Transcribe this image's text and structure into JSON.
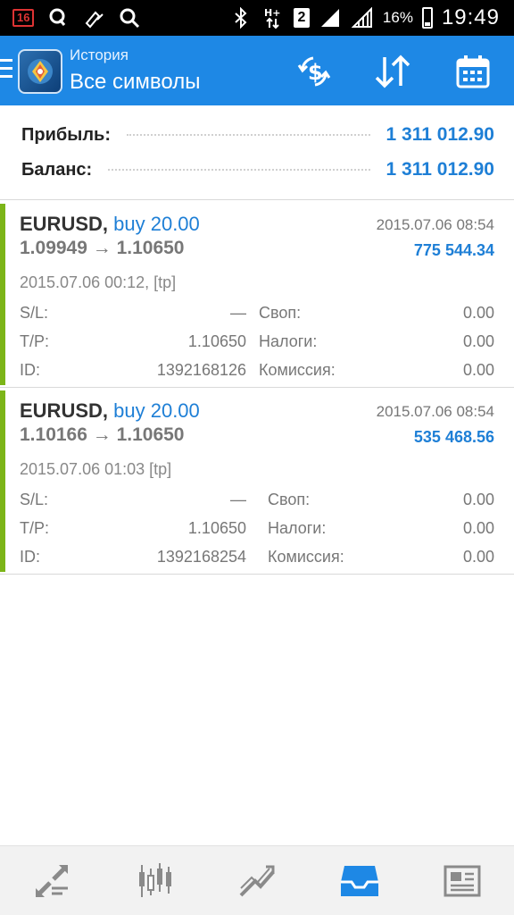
{
  "status_bar": {
    "notification_badge": "16",
    "sim_slot": "2",
    "battery_percent": "16%",
    "time": "19:49",
    "icons": [
      "notification-badge",
      "qiwi-visa-icon",
      "pen-coins-icon",
      "search-icon",
      "bluetooth-icon",
      "data-arrows-icon",
      "sim-icon",
      "signal-icon",
      "signal-icon",
      "battery-icon"
    ]
  },
  "app_bar": {
    "title_small": "История",
    "title_big": "Все символы",
    "accent_color": "#1e88e5",
    "actions": [
      "currency-exchange-icon",
      "sort-arrows-icon",
      "calendar-icon"
    ]
  },
  "summary": {
    "profit_label": "Прибыль:",
    "profit_value": "1 311 012.90",
    "balance_label": "Баланс:",
    "balance_value": "1 311 012.90"
  },
  "deals": [
    {
      "symbol": "EURUSD,",
      "type": "buy 20.00",
      "prices": "1.09949 → 1.10650",
      "close_time": "2015.07.06 08:54",
      "profit": "775 544.34",
      "open_info": "2015.07.06 00:12, [tp]",
      "sl_label": "S/L:",
      "sl_value": "—",
      "tp_label": "T/P:",
      "tp_value": "1.10650",
      "id_label": "ID:",
      "id_value": "1392168126",
      "swap_label": "Своп:",
      "swap_value": "0.00",
      "tax_label": "Налоги:",
      "tax_value": "0.00",
      "commission_label": "Комиссия:",
      "commission_value": "0.00"
    },
    {
      "symbol": "EURUSD,",
      "type": "buy 20.00",
      "prices": "1.10166 → 1.10650",
      "close_time": "2015.07.06 08:54",
      "profit": "535 468.56",
      "open_info": "2015.07.06 01:03 [tp]",
      "sl_label": "S/L:",
      "sl_value": "—",
      "tp_label": "T/P:",
      "tp_value": "1.10650",
      "id_label": "ID:",
      "id_value": "1392168254",
      "swap_label": "Своп:",
      "swap_value": "0.00",
      "tax_label": "Налоги:",
      "tax_value": "0.00",
      "commission_label": "Комиссия:",
      "commission_value": "0.00"
    }
  ],
  "bottom_nav": {
    "items": [
      "quotes-icon",
      "chart-icon",
      "trade-icon",
      "history-icon",
      "news-icon"
    ],
    "active": "history-icon",
    "active_color": "#1e88e5",
    "inactive_color": "#8a8a8a"
  }
}
